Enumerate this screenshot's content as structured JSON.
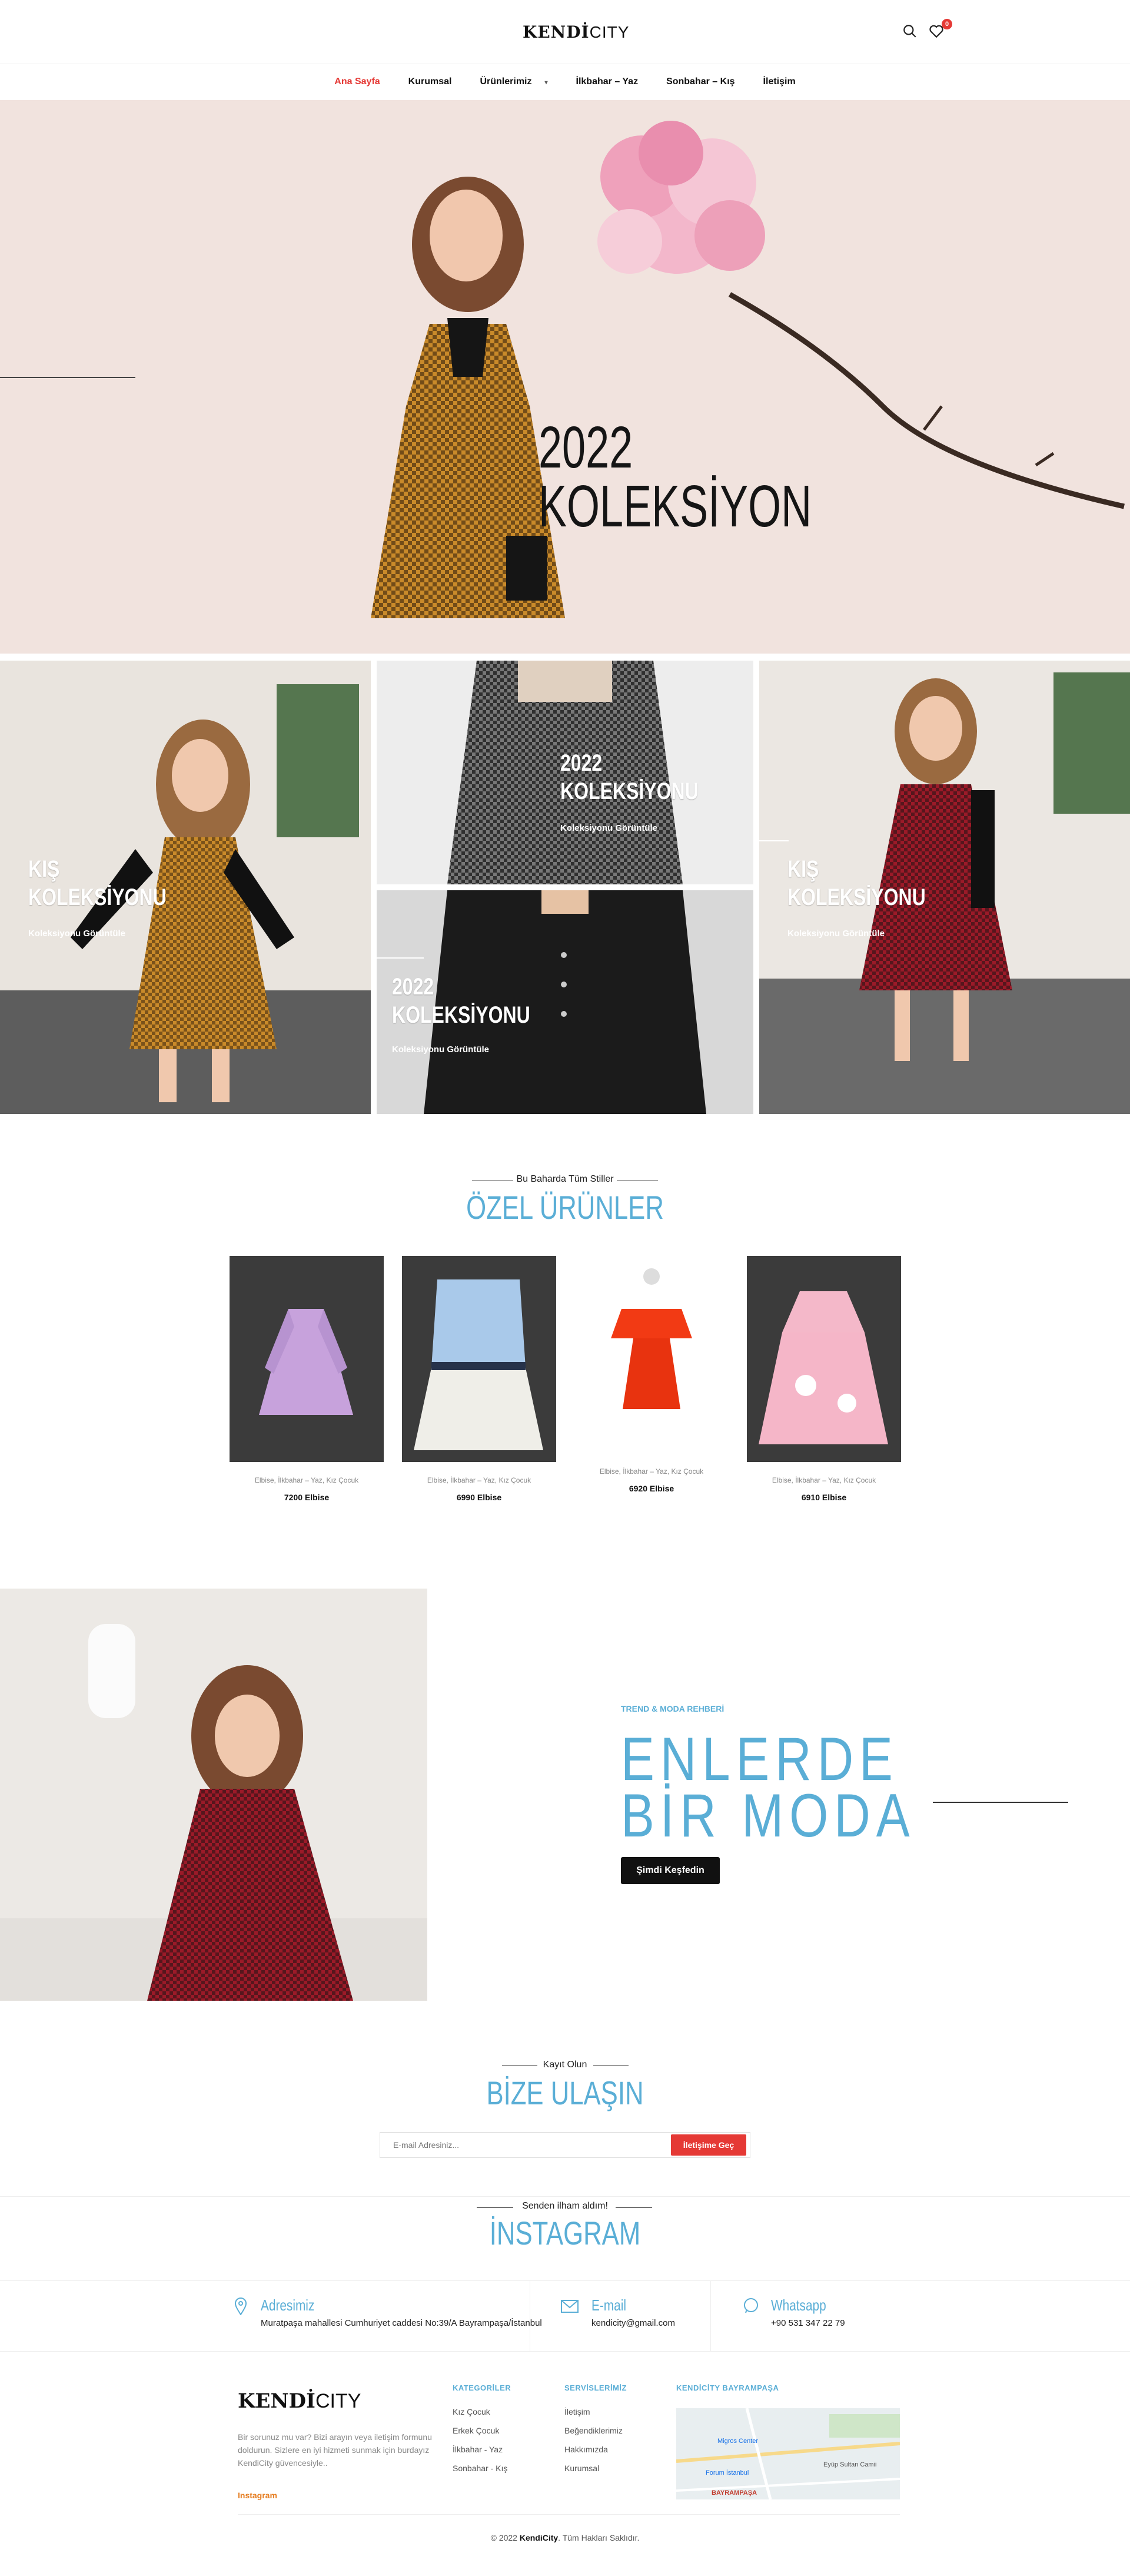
{
  "header": {
    "logo_bold": "KENDİ",
    "logo_light": "CITY",
    "cart_count": "0"
  },
  "nav": [
    {
      "label": "Ana Sayfa",
      "active": true
    },
    {
      "label": "Kurumsal"
    },
    {
      "label": "Ürünlerimiz",
      "has_dropdown": true
    },
    {
      "label": "İlkbahar – Yaz"
    },
    {
      "label": "Sonbahar – Kış"
    },
    {
      "label": "İletişim"
    }
  ],
  "hero": {
    "line1": "2022",
    "line2": "KOLEKSİYON"
  },
  "collections": {
    "left": {
      "title1": "KIŞ",
      "title2": "KOLEKSİYONU",
      "link": "Koleksiyonu Görüntüle"
    },
    "top_center": {
      "title1": "2022",
      "title2": "KOLEKSİYONU",
      "link": "Koleksiyonu Görüntüle"
    },
    "bottom_center": {
      "title1": "2022",
      "title2": "KOLEKSİYONU",
      "link": "Koleksiyonu Görüntüle"
    },
    "right": {
      "title1": "KIŞ",
      "title2": "KOLEKSİYONU",
      "link": "Koleksiyonu Görüntüle"
    }
  },
  "featured": {
    "kicker": "Bu Baharda Tüm Stiller",
    "title": "ÖZEL ÜRÜNLER",
    "products": [
      {
        "category": "Elbise, İlkbahar – Yaz, Kız Çocuk",
        "name": "7200 Elbise"
      },
      {
        "category": "Elbise, İlkbahar – Yaz, Kız Çocuk",
        "name": "6990 Elbise"
      },
      {
        "category": "Elbise, İlkbahar – Yaz, Kız Çocuk",
        "name": "6920 Elbise"
      },
      {
        "category": "Elbise, İlkbahar – Yaz, Kız Çocuk",
        "name": "6910 Elbise"
      }
    ]
  },
  "promo": {
    "kicker": "TREND & MODA REHBERİ",
    "title1": "ENLERDE",
    "title2": "BİR MODA",
    "button": "Şimdi Keşfedin"
  },
  "contact": {
    "kicker": "Kayıt Olun",
    "title": "BİZE ULAŞIN",
    "email_placeholder": "E-mail Adresiniz...",
    "button": "İletişime Geç"
  },
  "instagram": {
    "kicker": "Senden ilham aldım!",
    "title": "İNSTAGRAM"
  },
  "info": {
    "address_title": "Adresimiz",
    "address": "Muratpaşa mahallesi Cumhuriyet caddesi No:39/A Bayrampaşa/İstanbul",
    "email_title": "E-mail",
    "email": "kendicity@gmail.com",
    "whatsapp_title": "Whatsapp",
    "whatsapp": "+90 531 347 22 79"
  },
  "footer": {
    "about": "Bir sorunuz mu var? Bizi arayın veya iletişim formunu doldurun. Sizlere en iyi hizmeti sunmak için burdayız KendiCity güvencesiyle..",
    "instagram_link": "Instagram",
    "col1_title": "KATEGORİLER",
    "col1": [
      "Kız Çocuk",
      "Erkek Çocuk",
      "İlkbahar - Yaz",
      "Sonbahar - Kış"
    ],
    "col2_title": "SERVİSLERİMİZ",
    "col2": [
      "İletişim",
      "Beğendiklerimiz",
      "Hakkımızda",
      "Kurumsal"
    ],
    "col3_title": "KENDİCİTY BAYRAMPAŞA",
    "map_labels": [
      "Migros Center",
      "Forum İstanbul",
      "BAYRAMPAŞA",
      "Eyüp Sultan Camii"
    ],
    "copyright_pre": "© 2022",
    "copyright_brand": "KendiCity",
    "copyright_post": "Tüm Hakları Saklıdır."
  },
  "colors": {
    "accent_blue": "#5aaed6",
    "accent_red": "#e53935",
    "hero_bg": "#f1e3de"
  }
}
